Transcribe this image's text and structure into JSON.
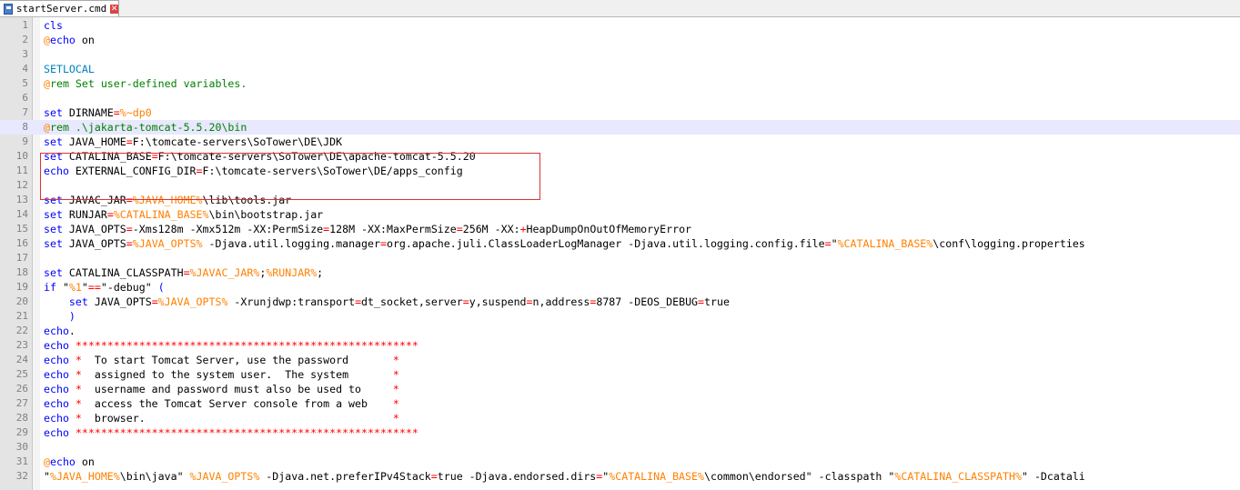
{
  "tab": {
    "label": "startServer.cmd",
    "close": "✕"
  },
  "editor": {
    "current_line": 8
  },
  "lines": [
    [
      [
        "kw",
        "cls"
      ]
    ],
    [
      [
        "at",
        "@"
      ],
      [
        "kw",
        "echo"
      ],
      [
        "p",
        " on"
      ]
    ],
    [],
    [
      [
        "kw2",
        "SETLOCAL"
      ]
    ],
    [
      [
        "at",
        "@"
      ],
      [
        "cm",
        "rem Set user-defined variables."
      ]
    ],
    [],
    [
      [
        "kw",
        "set"
      ],
      [
        "p",
        " DIRNAME"
      ],
      [
        "op",
        "="
      ],
      [
        "var",
        "%~dp0"
      ]
    ],
    [
      [
        "at",
        "@"
      ],
      [
        "cm",
        "rem .\\jakarta-tomcat-5.5.20\\bin"
      ]
    ],
    [
      [
        "kw",
        "set"
      ],
      [
        "p",
        " JAVA_HOME"
      ],
      [
        "op",
        "="
      ],
      [
        "p",
        "F:\\tomcate-servers\\SoTower\\DE\\JDK"
      ]
    ],
    [
      [
        "kw",
        "set"
      ],
      [
        "p",
        " CATALINA_BASE"
      ],
      [
        "op",
        "="
      ],
      [
        "p",
        "F:\\tomcate-servers\\SoTower\\DE\\apache-tomcat-5.5.20"
      ]
    ],
    [
      [
        "kw",
        "echo"
      ],
      [
        "p",
        " EXTERNAL_CONFIG_DIR"
      ],
      [
        "op",
        "="
      ],
      [
        "p",
        "F:\\tomcate-servers\\SoTower\\DE/apps_config"
      ]
    ],
    [],
    [
      [
        "kw",
        "set"
      ],
      [
        "p",
        " JAVAC_JAR"
      ],
      [
        "op",
        "="
      ],
      [
        "var",
        "%JAVA_HOME%"
      ],
      [
        "p",
        "\\lib\\tools.jar"
      ]
    ],
    [
      [
        "kw",
        "set"
      ],
      [
        "p",
        " RUNJAR"
      ],
      [
        "op",
        "="
      ],
      [
        "var",
        "%CATALINA_BASE%"
      ],
      [
        "p",
        "\\bin\\bootstrap.jar"
      ]
    ],
    [
      [
        "kw",
        "set"
      ],
      [
        "p",
        " JAVA_OPTS"
      ],
      [
        "op",
        "="
      ],
      [
        "p",
        "-Xms128m -Xmx512m -XX:PermSize"
      ],
      [
        "op",
        "="
      ],
      [
        "p",
        "128M -XX:MaxPermSize"
      ],
      [
        "op",
        "="
      ],
      [
        "p",
        "256M -XX:"
      ],
      [
        "op",
        "+"
      ],
      [
        "p",
        "HeapDumpOnOutOfMemoryError"
      ]
    ],
    [
      [
        "kw",
        "set"
      ],
      [
        "p",
        " JAVA_OPTS"
      ],
      [
        "op",
        "="
      ],
      [
        "var",
        "%JAVA_OPTS%"
      ],
      [
        "p",
        " -Djava.util.logging.manager"
      ],
      [
        "op",
        "="
      ],
      [
        "p",
        "org.apache.juli.ClassLoaderLogManager -Djava.util.logging.config.file"
      ],
      [
        "op",
        "="
      ],
      [
        "p",
        "\""
      ],
      [
        "var",
        "%CATALINA_BASE%"
      ],
      [
        "p",
        "\\conf\\logging.properties"
      ]
    ],
    [],
    [
      [
        "kw",
        "set"
      ],
      [
        "p",
        " CATALINA_CLASSPATH"
      ],
      [
        "op",
        "="
      ],
      [
        "var",
        "%JAVAC_JAR%"
      ],
      [
        "p",
        ";"
      ],
      [
        "var",
        "%RUNJAR%"
      ],
      [
        "p",
        ";"
      ]
    ],
    [
      [
        "kw",
        "if"
      ],
      [
        "p",
        " \""
      ],
      [
        "var",
        "%1"
      ],
      [
        "p",
        "\""
      ],
      [
        "op",
        "=="
      ],
      [
        "p",
        "\"-debug\" "
      ],
      [
        "kw",
        "("
      ]
    ],
    [
      [
        "p",
        "    "
      ],
      [
        "kw",
        "set"
      ],
      [
        "p",
        " JAVA_OPTS"
      ],
      [
        "op",
        "="
      ],
      [
        "var",
        "%JAVA_OPTS%"
      ],
      [
        "p",
        " -Xrunjdwp:transport"
      ],
      [
        "op",
        "="
      ],
      [
        "p",
        "dt_socket,server"
      ],
      [
        "op",
        "="
      ],
      [
        "p",
        "y,suspend"
      ],
      [
        "op",
        "="
      ],
      [
        "p",
        "n,address"
      ],
      [
        "op",
        "="
      ],
      [
        "p",
        "8787 -DEOS_DEBUG"
      ],
      [
        "op",
        "="
      ],
      [
        "p",
        "true"
      ]
    ],
    [
      [
        "p",
        "    "
      ],
      [
        "kw",
        ")"
      ]
    ],
    [
      [
        "kw",
        "echo"
      ],
      [
        "p",
        "."
      ]
    ],
    [
      [
        "kw",
        "echo"
      ],
      [
        "p",
        " "
      ],
      [
        "op",
        "******************************************************"
      ]
    ],
    [
      [
        "kw",
        "echo"
      ],
      [
        "p",
        " "
      ],
      [
        "op",
        "*"
      ],
      [
        "p",
        "  To start Tomcat Server, use the password       "
      ],
      [
        "op",
        "*"
      ]
    ],
    [
      [
        "kw",
        "echo"
      ],
      [
        "p",
        " "
      ],
      [
        "op",
        "*"
      ],
      [
        "p",
        "  assigned to the system user.  The system       "
      ],
      [
        "op",
        "*"
      ]
    ],
    [
      [
        "kw",
        "echo"
      ],
      [
        "p",
        " "
      ],
      [
        "op",
        "*"
      ],
      [
        "p",
        "  username and password must also be used to     "
      ],
      [
        "op",
        "*"
      ]
    ],
    [
      [
        "kw",
        "echo"
      ],
      [
        "p",
        " "
      ],
      [
        "op",
        "*"
      ],
      [
        "p",
        "  access the Tomcat Server console from a web    "
      ],
      [
        "op",
        "*"
      ]
    ],
    [
      [
        "kw",
        "echo"
      ],
      [
        "p",
        " "
      ],
      [
        "op",
        "*"
      ],
      [
        "p",
        "  browser.                                       "
      ],
      [
        "op",
        "*"
      ]
    ],
    [
      [
        "kw",
        "echo"
      ],
      [
        "p",
        " "
      ],
      [
        "op",
        "******************************************************"
      ]
    ],
    [],
    [
      [
        "at",
        "@"
      ],
      [
        "kw",
        "echo"
      ],
      [
        "p",
        " on"
      ]
    ],
    [
      [
        "p",
        "\""
      ],
      [
        "var",
        "%JAVA_HOME%"
      ],
      [
        "p",
        "\\bin\\java\" "
      ],
      [
        "var",
        "%JAVA_OPTS%"
      ],
      [
        "p",
        " -Djava.net.preferIPv4Stack"
      ],
      [
        "op",
        "="
      ],
      [
        "p",
        "true -Djava.endorsed.dirs"
      ],
      [
        "op",
        "="
      ],
      [
        "p",
        "\""
      ],
      [
        "var",
        "%CATALINA_BASE%"
      ],
      [
        "p",
        "\\common\\endorsed\" -classpath \""
      ],
      [
        "var",
        "%CATALINA_CLASSPATH%"
      ],
      [
        "p",
        "\" -Dcatali"
      ]
    ]
  ]
}
